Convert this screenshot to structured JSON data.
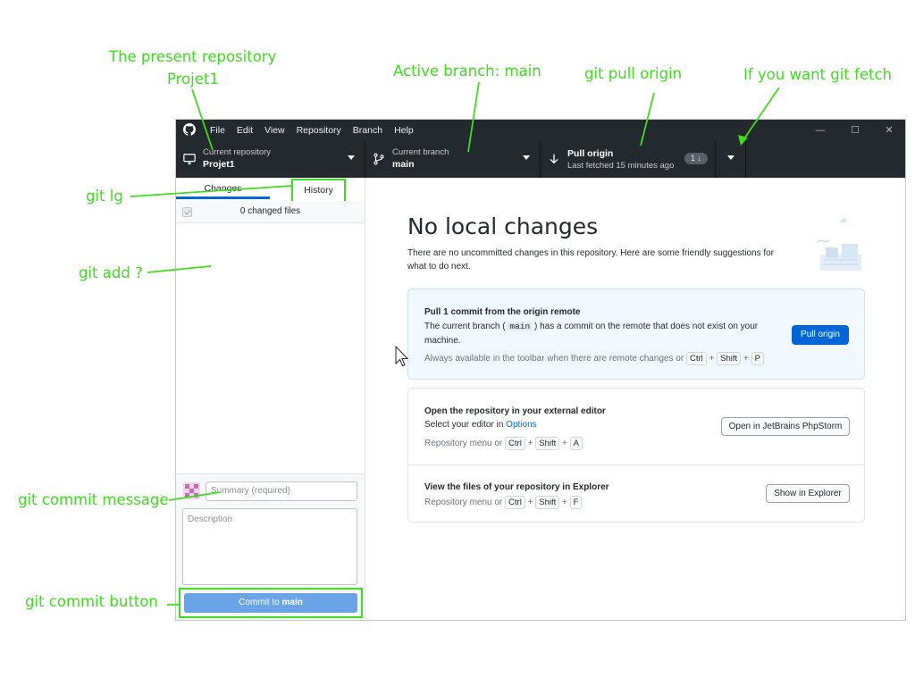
{
  "annotations": {
    "repo_line1": "The present repository",
    "repo_line2": "Projet1",
    "active_branch": "Active branch: main",
    "git_pull": "git pull origin",
    "git_fetch": "If you want git fetch",
    "git_lg": "git lg",
    "git_add": "git add ?",
    "commit_message": "git commit message",
    "commit_button": "git commit button"
  },
  "menu": [
    "File",
    "Edit",
    "View",
    "Repository",
    "Branch",
    "Help"
  ],
  "window_controls": [
    "—",
    "☐",
    "✕"
  ],
  "toolbar": {
    "repo_label": "Current repository",
    "repo_value": "Projet1",
    "branch_label": "Current branch",
    "branch_value": "main",
    "pull_label": "Pull origin",
    "pull_sub": "Last fetched 15 minutes ago",
    "pull_badge": "1 ↓"
  },
  "sidebar": {
    "tab_changes": "Changes",
    "tab_history": "History",
    "changed_files": "0 changed files",
    "summary_placeholder": "Summary (required)",
    "description_placeholder": "Description",
    "commit_prefix": "Commit to ",
    "commit_branch": "main"
  },
  "main": {
    "title": "No local changes",
    "description": "There are no uncommitted changes in this repository. Here are some friendly suggestions for what to do next.",
    "card_pull": {
      "title": "Pull 1 commit from the origin remote",
      "text_before": "The current branch (",
      "text_code": "main",
      "text_after": ") has a commit on the remote that does not exist on your machine.",
      "hint": "Always available in the toolbar when there are remote changes or",
      "keys": [
        "Ctrl",
        "Shift",
        "P"
      ],
      "button": "Pull origin"
    },
    "card_editor": {
      "title": "Open the repository in your external editor",
      "text": "Select your editor in ",
      "link": "Options",
      "hint": "Repository menu or",
      "keys": [
        "Ctrl",
        "Shift",
        "A"
      ],
      "button": "Open in JetBrains PhpStorm"
    },
    "card_explorer": {
      "title": "View the files of your repository in Explorer",
      "hint": "Repository menu or",
      "keys": [
        "Ctrl",
        "Shift",
        "F"
      ],
      "button": "Show in Explorer"
    }
  },
  "colors": {
    "annotation": "#3fdc1f",
    "toolbar_bg": "#24292e",
    "accent_blue": "#0366d6"
  }
}
